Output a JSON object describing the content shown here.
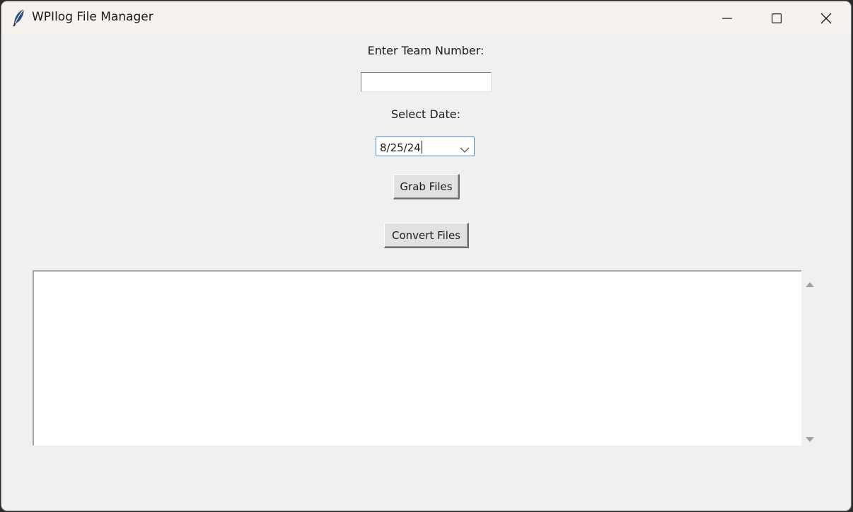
{
  "window": {
    "title": "WPIlog File Manager",
    "icon": "feather-icon",
    "controls": [
      "minimize-icon",
      "maximize-icon",
      "close-icon"
    ]
  },
  "form": {
    "team_label": "Enter Team Number:",
    "team_value": "",
    "date_label": "Select Date:",
    "date_value": "8/25/24",
    "grab_label": "Grab Files",
    "convert_label": "Convert Files"
  },
  "log": {
    "content": ""
  },
  "colors": {
    "window_bg": "#f0f0f0",
    "titlebar_bg": "#f6f3ef",
    "focus_border": "#4a8fd6",
    "scroll_arrow": "#a0a0a0"
  }
}
